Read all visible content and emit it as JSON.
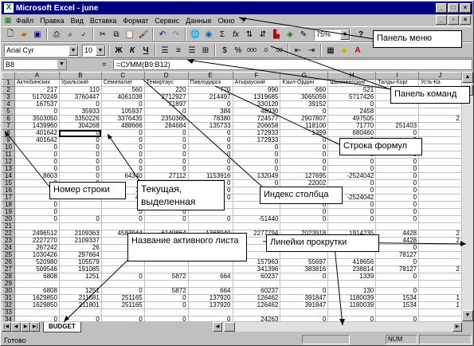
{
  "window": {
    "title": "Microsoft Excel - june",
    "app_icon": "excel-icon"
  },
  "menu": [
    "Файл",
    "Правка",
    "Вид",
    "Вставка",
    "Формат",
    "Сервис",
    "Данные",
    "Окно",
    "?"
  ],
  "toolbar": {
    "zoom": "75%",
    "font_name": "Arial Cyr",
    "font_size": "10",
    "bold": "Ж",
    "italic": "К",
    "underline": "Ч",
    "sum": "Σ",
    "fx": "fx",
    "percent": "%",
    "thousands": "000",
    "help": "?"
  },
  "formula_bar": {
    "cell_ref": "B8",
    "equals": "=",
    "formula": "=СУММ(B9:B12)"
  },
  "columns": [
    "A",
    "B",
    "C",
    "D",
    "E",
    "F",
    "G",
    "H",
    "I",
    "J"
  ],
  "column_headers": [
    "Актюбинских",
    "Уральский",
    "Семипалат",
    "Темиртаус",
    "Павлодарск",
    "Атырауский",
    "Кзыл-Ордин",
    "Шымкентских",
    "Талды-Корг",
    "Усть-Ка"
  ],
  "rows": [
    [
      "217",
      "110",
      "560",
      "220",
      "770",
      "990",
      "660",
      "521",
      "13",
      ""
    ],
    [
      "5170249",
      "3760447",
      "4061038",
      "2712927",
      "214497",
      "1319685",
      "3065059",
      "5717426",
      "",
      ""
    ],
    [
      "167537",
      "0",
      "0",
      "71897",
      "0",
      "330120",
      "39152",
      "0",
      "",
      ""
    ],
    [
      "0",
      "35933",
      "105937",
      "0",
      "384",
      "48930",
      "0",
      "2458",
      "",
      ""
    ],
    [
      "3503050",
      "3350226",
      "3376435",
      "2350360",
      "78380",
      "724577",
      "2907807",
      "497505",
      "",
      "2"
    ],
    [
      "1439960",
      "304268",
      "488666",
      "284684",
      "135733",
      "206658",
      "118100",
      "71770",
      "251403",
      ""
    ],
    [
      "401642",
      "0",
      "0",
      "0",
      "0",
      "172933",
      "1399",
      "680460",
      "0",
      ""
    ],
    [
      "401642",
      "0",
      "0",
      "0",
      "0",
      "172933",
      "0",
      "0",
      "0",
      ""
    ],
    [
      "0",
      "0",
      "0",
      "0",
      "0",
      "0",
      "0",
      "0",
      "0",
      ""
    ],
    [
      "0",
      "0",
      "0",
      "0",
      "0",
      "0",
      "0",
      "0",
      "0",
      ""
    ],
    [
      "0",
      "0",
      "0",
      "0",
      "0",
      "0",
      "0",
      "0",
      "0",
      ""
    ],
    [
      "0",
      "0",
      "0",
      "0",
      "0",
      "0",
      "0",
      "0",
      "0",
      ""
    ],
    [
      "8603",
      "0",
      "64340",
      "27112",
      "1153916",
      "132049",
      "127695",
      "-2524042",
      "0",
      ""
    ],
    [
      "0",
      "0",
      "0",
      "26850",
      "0",
      "0",
      "22002",
      "0",
      "0",
      ""
    ],
    [
      "",
      "0",
      "12",
      "0",
      "0",
      "30",
      "1399",
      "0",
      "0",
      ""
    ],
    [
      "",
      "0",
      "49",
      "0",
      "0",
      "0",
      "0",
      "-2524042",
      "0",
      ""
    ],
    [
      "0",
      "",
      "0",
      "0",
      "",
      "",
      "0",
      "0",
      "0",
      ""
    ],
    [
      "0",
      "",
      "0",
      "0",
      "",
      "",
      "0",
      "0",
      "0",
      ""
    ],
    [
      "0",
      "0",
      "0",
      "0",
      "0",
      "-51440",
      "0",
      "0",
      "0",
      ""
    ],
    [
      "",
      "",
      "",
      "",
      "",
      "",
      "",
      "",
      "",
      ""
    ],
    [
      "2496512",
      "2109363",
      "4587944",
      "6140864",
      "1368040",
      "2277794",
      "2023918",
      "1914235",
      "4428",
      "2"
    ],
    [
      "2227270",
      "2109337",
      "",
      "6140864",
      "1368040",
      "",
      "",
      "1914235",
      "4428",
      "2"
    ],
    [
      "267242",
      "26",
      "",
      "",
      "",
      "",
      "",
      "",
      "0",
      ""
    ],
    [
      "1030426",
      "297664",
      "",
      "",
      "",
      "",
      "",
      "",
      "78127",
      ""
    ],
    [
      "520980",
      "105579",
      "",
      "",
      "",
      "157963",
      "55697",
      "418656",
      "0",
      ""
    ],
    [
      "509546",
      "191085",
      "",
      "",
      "",
      "341396",
      "383816",
      "238814",
      "78127",
      "2"
    ],
    [
      "6808",
      "1251",
      "0",
      "5872",
      "664",
      "60237",
      "0",
      "1339",
      "0",
      ""
    ],
    [
      "",
      "",
      "",
      "",
      "",
      "",
      "",
      "",
      "",
      ""
    ],
    [
      "6808",
      "1251",
      "0",
      "5872",
      "664",
      "60237",
      "0",
      "130",
      "0",
      ""
    ],
    [
      "1629850",
      "211681",
      "251165",
      "0",
      "137920",
      "126462",
      "391847",
      "1180039",
      "1534",
      "1"
    ],
    [
      "1629850",
      "211801",
      "251165",
      "0",
      "137920",
      "126462",
      "391847",
      "1180039",
      "1534",
      "1"
    ],
    [
      "",
      "",
      "",
      "",
      "",
      "",
      "",
      "",
      "",
      ""
    ],
    [
      "0",
      "0",
      "0",
      "0",
      "0",
      "24263",
      "0",
      "0",
      "0",
      ""
    ],
    [
      "",
      "",
      "",
      "",
      "",
      "",
      "",
      "",
      "",
      ""
    ]
  ],
  "sheet_tab": "BUDGET",
  "status": {
    "ready": "Готово",
    "num": "NUM"
  },
  "callouts": {
    "menu_panel": "Панель меню",
    "command_panel": "Панель команд",
    "formula_row": "Строка формул",
    "row_number": "Номер строки",
    "current_cell": "Текущая, выделенная",
    "column_index": "Индекс столбца",
    "sheet_name": "Название активного листа",
    "scrollbars": "Линейки прокрутки"
  },
  "colors": {
    "title_bar": "#000080",
    "chrome": "#c0c0c0",
    "callout_bg": "#ffffff"
  }
}
